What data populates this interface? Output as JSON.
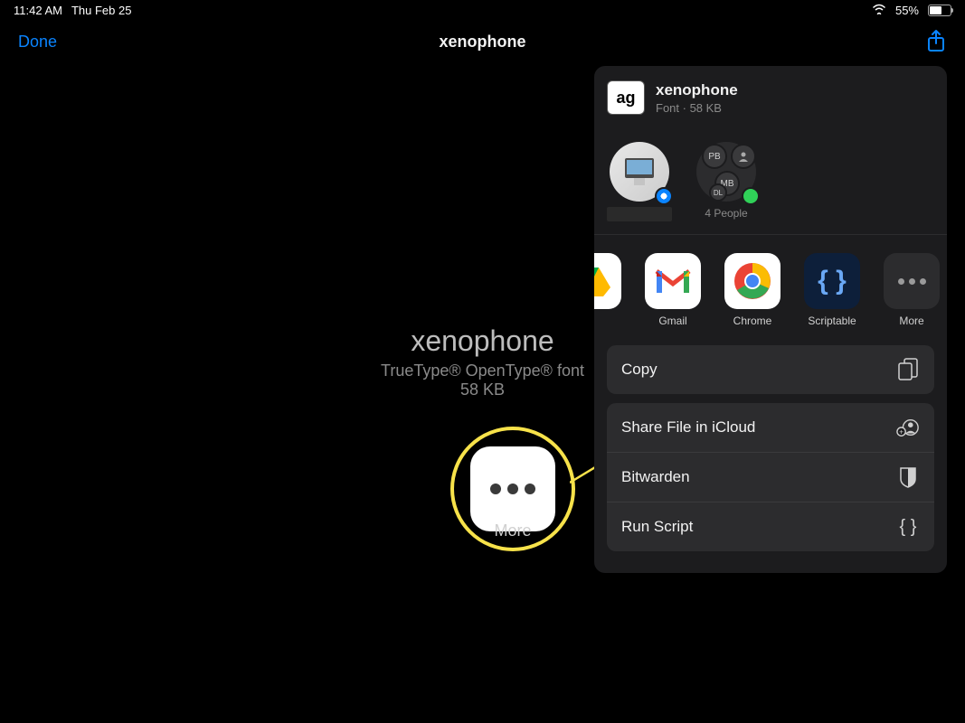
{
  "status": {
    "time": "11:42 AM",
    "date": "Thu Feb 25",
    "battery": "55%"
  },
  "nav": {
    "done": "Done",
    "title": "xenophone"
  },
  "file": {
    "name": "xenophone",
    "type": "TrueType® OpenType® font",
    "size": "58 KB"
  },
  "annotation": {
    "label": "More"
  },
  "sheet": {
    "header": {
      "thumb": "ag",
      "title": "xenophone",
      "meta": "Font · 58 KB"
    },
    "people": {
      "group_label": "4 People",
      "contact1_initials": "PB",
      "contact2_initials": "MB",
      "contact3_initials": "DL"
    },
    "apps": {
      "gmail": "Gmail",
      "chrome": "Chrome",
      "scriptable": "Scriptable",
      "more": "More"
    },
    "actions": {
      "copy": "Copy",
      "share_icloud": "Share File in iCloud",
      "bitwarden": "Bitwarden",
      "run_script": "Run Script"
    }
  }
}
